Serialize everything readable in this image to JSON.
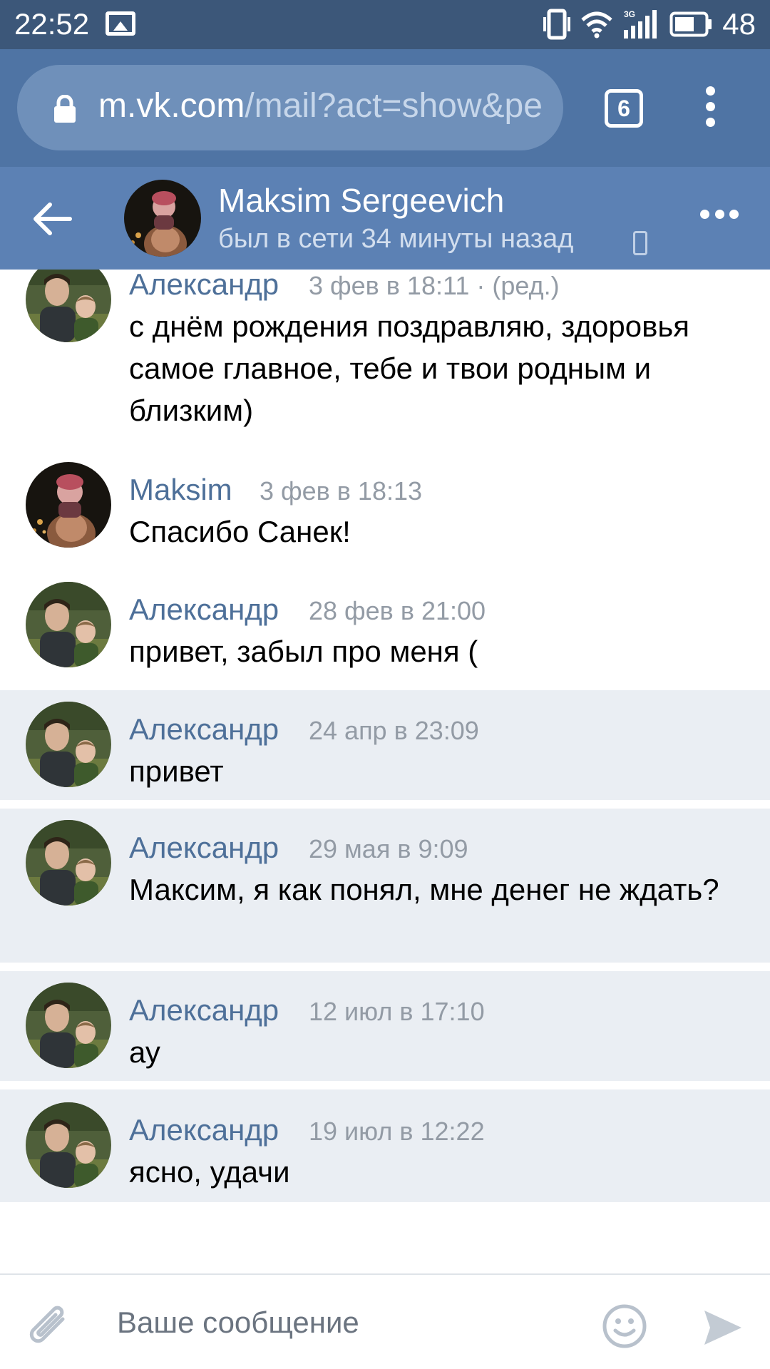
{
  "status_bar": {
    "time": "22:52",
    "battery": "48",
    "icons": [
      "image-notification-icon",
      "vibrate-icon",
      "wifi-icon",
      "signal-3g-icon",
      "battery-icon"
    ]
  },
  "browser": {
    "url_host": "m.vk.com",
    "url_path": "/mail?act=show&pe",
    "tab_count": "6"
  },
  "chat_header": {
    "name": "Maksim Sergeevich",
    "status": "был в сети 34 минуты назад"
  },
  "messages": [
    {
      "author": "Александр",
      "date": "3 фев в 18:11 · (ред.)",
      "text": "с днём рождения поздравляю, здоровья самое главное, тебе и твои родным и близким)",
      "unread": false,
      "avatar": "alexandr"
    },
    {
      "author": "Maksim",
      "date": "3 фев в 18:13",
      "text": "Спасибо Санек!",
      "unread": false,
      "avatar": "maksim"
    },
    {
      "author": "Александр",
      "date": "28 фев в 21:00",
      "text": "привет, забыл про меня (",
      "unread": false,
      "avatar": "alexandr"
    },
    {
      "author": "Александр",
      "date": "24 апр в 23:09",
      "text": "привет",
      "unread": true,
      "avatar": "alexandr"
    },
    {
      "author": "Александр",
      "date": "29 мая в 9:09",
      "text": "Максим, я как понял, мне денег не ждать?",
      "unread": true,
      "avatar": "alexandr"
    },
    {
      "author": "Александр",
      "date": "12 июл в 17:10",
      "text": "ау",
      "unread": true,
      "avatar": "alexandr"
    },
    {
      "author": "Александр",
      "date": "19 июл в 12:22",
      "text": "ясно, удачи",
      "unread": true,
      "avatar": "alexandr"
    }
  ],
  "composer": {
    "placeholder": "Ваше сообщение"
  },
  "colors": {
    "status_bar": "#3c5779",
    "browser_bar": "#4f74a4",
    "header": "#5c81b4",
    "author_link": "#4e7099",
    "unread_bg": "#eaeef3"
  }
}
